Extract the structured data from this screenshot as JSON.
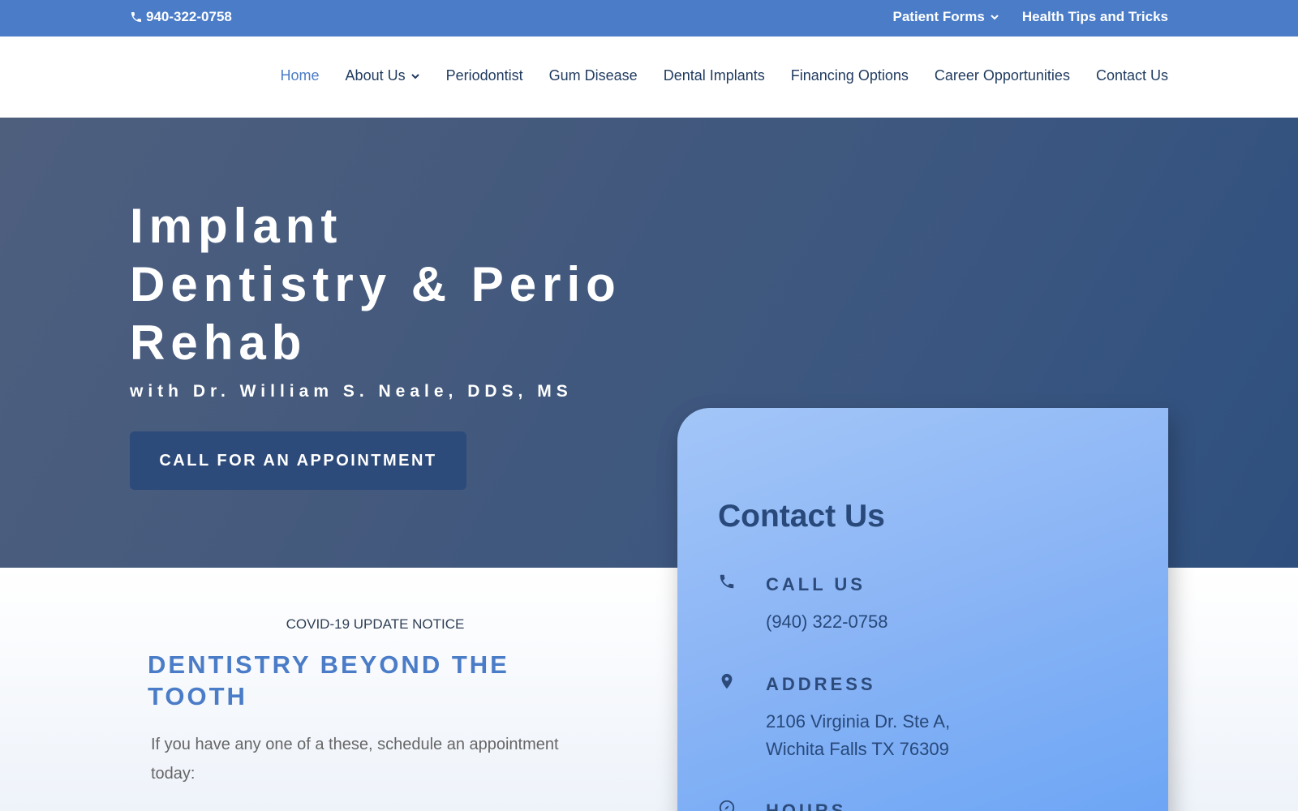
{
  "topbar": {
    "phone": "940-322-0758",
    "patient_forms": "Patient Forms",
    "health_tips": "Health Tips and Tricks"
  },
  "nav": {
    "items": [
      {
        "label": "Home"
      },
      {
        "label": "About Us"
      },
      {
        "label": "Periodontist"
      },
      {
        "label": "Gum Disease"
      },
      {
        "label": "Dental Implants"
      },
      {
        "label": "Financing Options"
      },
      {
        "label": "Career Opportunities"
      },
      {
        "label": "Contact Us"
      }
    ]
  },
  "hero": {
    "title_line1": "Implant",
    "title_line2": "Dentistry & Perio",
    "title_line3": "Rehab",
    "subtitle": "with Dr. William S. Neale, DDS, MS",
    "cta": "CALL FOR AN APPOINTMENT"
  },
  "contact": {
    "title": "Contact Us",
    "call_label": "CALL US",
    "phone": "(940) 322-0758",
    "address_label": "ADDRESS",
    "address_line1": "2106 Virginia Dr. Ste A,",
    "address_line2": "Wichita Falls TX 76309",
    "hours_label": "HOURS"
  },
  "lower": {
    "notice": "COVID-19 UPDATE NOTICE",
    "heading_line1": "DENTISTRY BEYOND THE",
    "heading_line2": "TOOTH",
    "intro": "If you have any one of a these, schedule an appointment today:"
  },
  "colors": {
    "topbar": "#4a7cc7",
    "nav_text": "#1f3a5f",
    "nav_active": "#4a7cc7",
    "button": "#2c4a7a",
    "card_title": "#28497a"
  }
}
